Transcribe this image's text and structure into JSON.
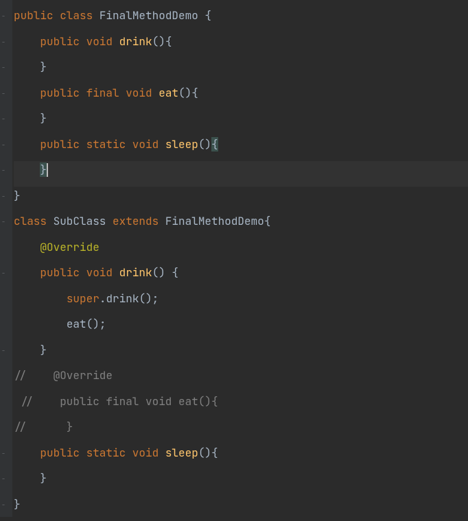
{
  "code": {
    "lines": [
      {
        "indent": 0,
        "tokens": [
          {
            "t": "kw",
            "v": "public class "
          },
          {
            "t": "cls",
            "v": "FinalMethodDemo "
          },
          {
            "t": "brace",
            "v": "{"
          }
        ],
        "fold": true
      },
      {
        "indent": 1,
        "tokens": [
          {
            "t": "kw",
            "v": "public void "
          },
          {
            "t": "mth",
            "v": "drink"
          },
          {
            "t": "brace",
            "v": "(){"
          }
        ],
        "fold": true
      },
      {
        "indent": 1,
        "tokens": [
          {
            "t": "brace",
            "v": "}"
          }
        ],
        "close": true
      },
      {
        "indent": 1,
        "tokens": [
          {
            "t": "kw",
            "v": "public final void "
          },
          {
            "t": "mth",
            "v": "eat"
          },
          {
            "t": "brace",
            "v": "(){"
          }
        ],
        "fold": true
      },
      {
        "indent": 1,
        "tokens": [
          {
            "t": "brace",
            "v": "}"
          }
        ],
        "close": true
      },
      {
        "indent": 1,
        "tokens": [
          {
            "t": "kw",
            "v": "public static void "
          },
          {
            "t": "mth",
            "v": "sleep"
          },
          {
            "t": "brace",
            "v": "()"
          },
          {
            "t": "brace-match",
            "v": "{"
          }
        ],
        "fold": true
      },
      {
        "indent": 1,
        "tokens": [
          {
            "t": "brace-match",
            "v": "}"
          }
        ],
        "highlighted": true,
        "caret_after": true,
        "close": true
      },
      {
        "indent": 0,
        "tokens": [
          {
            "t": "brace",
            "v": "}"
          }
        ],
        "close": true
      },
      {
        "indent": 0,
        "tokens": [
          {
            "t": "kw",
            "v": "class "
          },
          {
            "t": "cls",
            "v": "SubClass "
          },
          {
            "t": "kw",
            "v": "extends "
          },
          {
            "t": "cls",
            "v": "FinalMethodDemo"
          },
          {
            "t": "brace",
            "v": "{"
          }
        ],
        "fold": true
      },
      {
        "indent": 1,
        "tokens": [
          {
            "t": "annot",
            "v": "@Override"
          }
        ]
      },
      {
        "indent": 1,
        "tokens": [
          {
            "t": "kw",
            "v": "public void "
          },
          {
            "t": "mth",
            "v": "drink"
          },
          {
            "t": "brace",
            "v": "() {"
          }
        ],
        "fold": true
      },
      {
        "indent": 2,
        "tokens": [
          {
            "t": "kw",
            "v": "super"
          },
          {
            "t": "brace",
            "v": "."
          },
          {
            "t": "cls",
            "v": "drink"
          },
          {
            "t": "brace",
            "v": "();"
          }
        ]
      },
      {
        "indent": 2,
        "tokens": [
          {
            "t": "cls",
            "v": "eat"
          },
          {
            "t": "brace",
            "v": "();"
          }
        ]
      },
      {
        "indent": 1,
        "tokens": [
          {
            "t": "brace",
            "v": "}"
          }
        ],
        "close": true
      },
      {
        "indent": 0,
        "tokens": [
          {
            "t": "comment",
            "v": "//    @Override"
          }
        ]
      },
      {
        "indent": 0,
        "tokens": [
          {
            "t": "comment",
            "v": " //    public final void eat(){"
          }
        ]
      },
      {
        "indent": 0,
        "tokens": [
          {
            "t": "comment",
            "v": "//      }"
          }
        ]
      },
      {
        "indent": 1,
        "tokens": [
          {
            "t": "kw",
            "v": "public static void "
          },
          {
            "t": "mth",
            "v": "sleep"
          },
          {
            "t": "brace",
            "v": "(){"
          }
        ],
        "fold": true
      },
      {
        "indent": 1,
        "tokens": [
          {
            "t": "brace",
            "v": "}"
          }
        ],
        "close": true
      },
      {
        "indent": 0,
        "tokens": [
          {
            "t": "brace",
            "v": "}"
          }
        ],
        "close": true
      }
    ]
  }
}
